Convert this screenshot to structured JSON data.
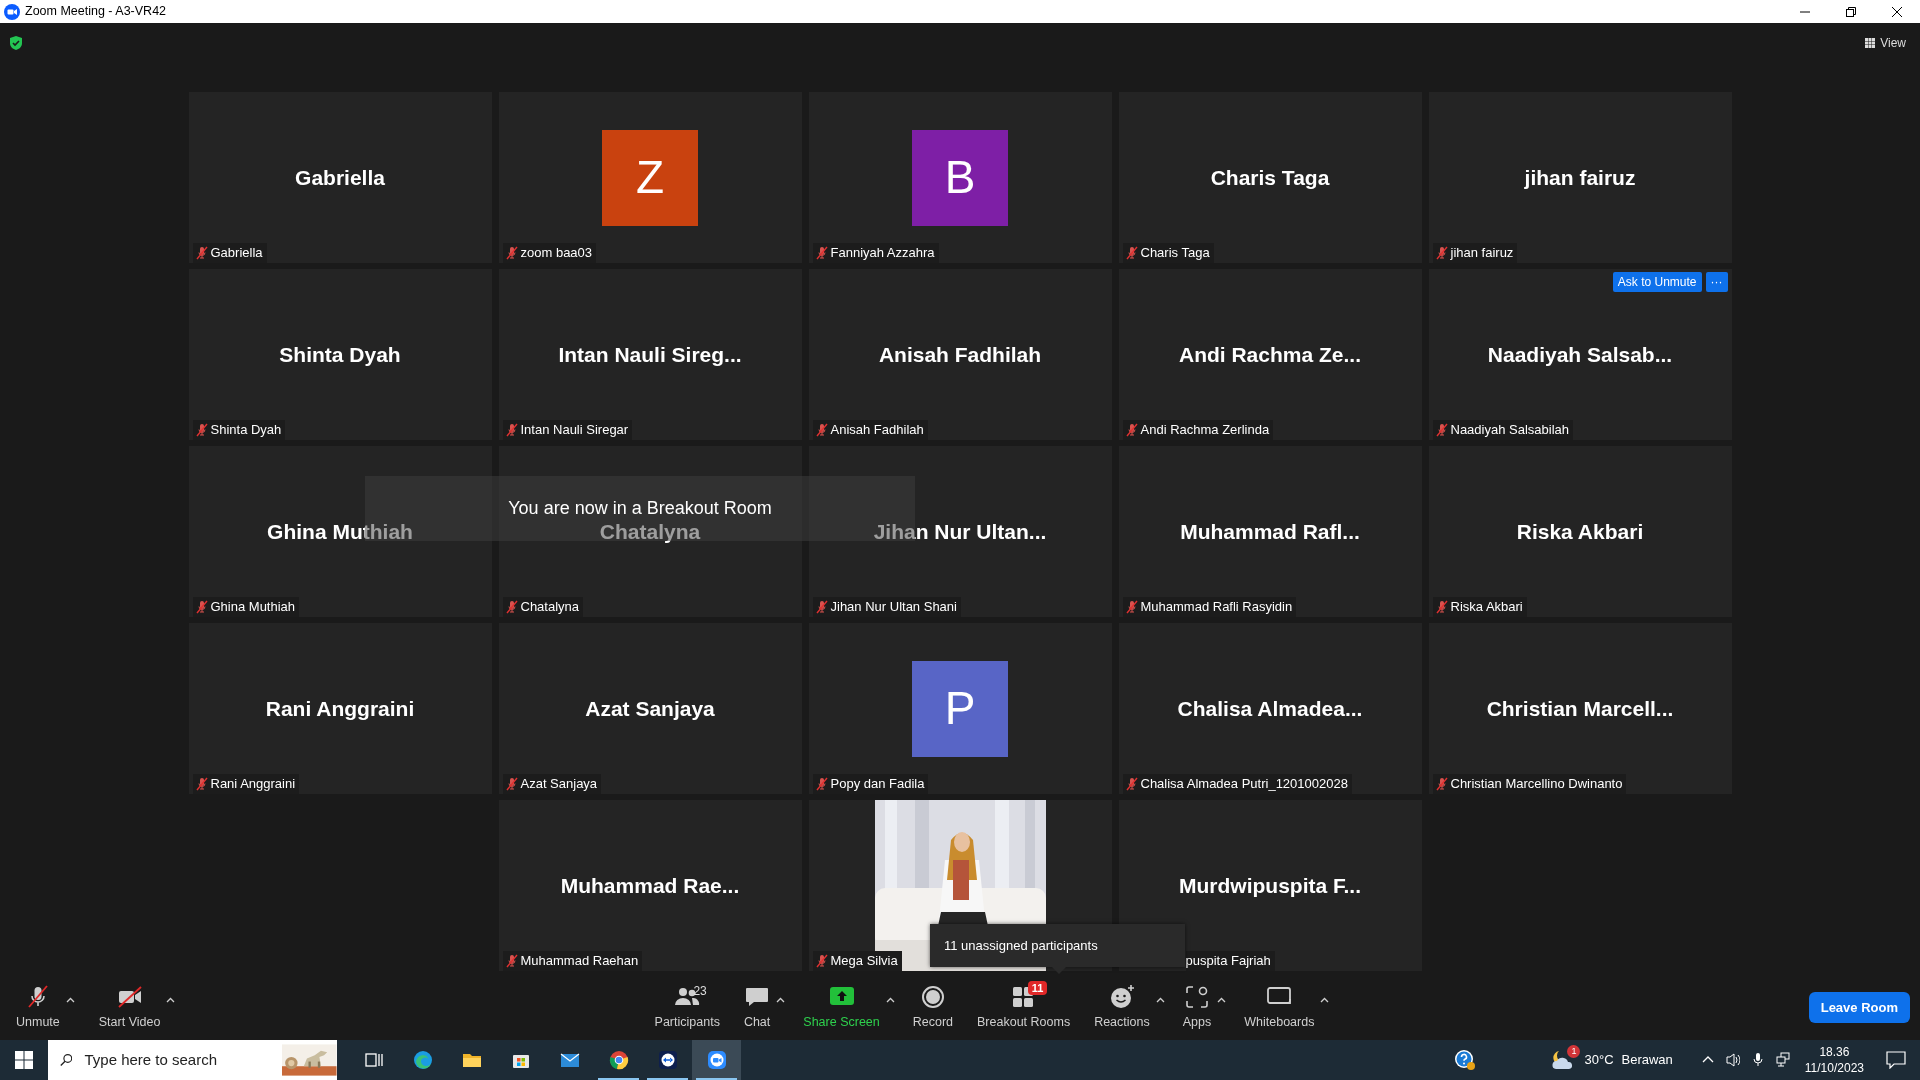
{
  "window": {
    "title": "Zoom Meeting - A3-VR42"
  },
  "top_bar": {
    "view_label": "View"
  },
  "tiles": [
    {
      "kind": "name",
      "display": "Gabriella",
      "label": "Gabriella",
      "muted": true
    },
    {
      "kind": "avatar",
      "display": "Z",
      "color": "#c9420f",
      "label": "zoom baa03",
      "muted": true
    },
    {
      "kind": "avatar",
      "display": "B",
      "color": "#7e1fa6",
      "label": "Fanniyah Azzahra",
      "muted": true
    },
    {
      "kind": "name",
      "display": "Charis Taga",
      "label": "Charis Taga",
      "muted": true
    },
    {
      "kind": "name",
      "display": "jihan fairuz",
      "label": "jihan fairuz",
      "muted": true
    },
    {
      "kind": "name",
      "display": "Shinta Dyah",
      "label": "Shinta Dyah",
      "muted": true
    },
    {
      "kind": "name",
      "display": "Intan Nauli Sireg...",
      "label": "Intan Nauli Siregar",
      "muted": true
    },
    {
      "kind": "name",
      "display": "Anisah Fadhilah",
      "label": "Anisah Fadhilah",
      "muted": true
    },
    {
      "kind": "name",
      "display": "Andi Rachma Ze...",
      "label": "Andi Rachma Zerlinda",
      "muted": true
    },
    {
      "kind": "name",
      "display": "Naadiyah Salsab...",
      "label": "Naadiyah Salsabilah",
      "muted": true,
      "actions": {
        "ask_to_unmute": "Ask to Unmute",
        "more": "···"
      }
    },
    {
      "kind": "name",
      "display": "Ghina Muthiah",
      "label": "Ghina Muthiah",
      "muted": true
    },
    {
      "kind": "name",
      "display": "Chatalyna",
      "label": "Chatalyna",
      "muted": true
    },
    {
      "kind": "name",
      "display": "Jihan Nur Ultan...",
      "label": "Jihan Nur Ultan Shani",
      "muted": true
    },
    {
      "kind": "name",
      "display": "Muhammad Rafl...",
      "label": "Muhammad Rafli Rasyidin",
      "muted": true
    },
    {
      "kind": "name",
      "display": "Riska Akbari",
      "label": "Riska Akbari",
      "muted": true
    },
    {
      "kind": "name",
      "display": "Rani Anggraini",
      "label": "Rani Anggraini",
      "muted": true
    },
    {
      "kind": "name",
      "display": "Azat Sanjaya",
      "label": "Azat Sanjaya",
      "muted": true
    },
    {
      "kind": "avatar",
      "display": "P",
      "color": "#5865c6",
      "label": "Popy dan Fadila",
      "muted": true
    },
    {
      "kind": "name",
      "display": "Chalisa Almadea...",
      "label": "Chalisa Almadea Putri_1201002028",
      "muted": true
    },
    {
      "kind": "name",
      "display": "Christian Marcell...",
      "label": "Christian Marcellino Dwinanto",
      "muted": true
    },
    {
      "kind": "name",
      "display": "Muhammad Rae...",
      "label": "Muhammad Raehan",
      "muted": true
    },
    {
      "kind": "video",
      "label": "Mega Silvia",
      "muted": true
    },
    {
      "kind": "name",
      "display": "Murdwipuspita F...",
      "label": "puspita Fajriah",
      "muted": true,
      "label_covered": true
    }
  ],
  "notice": "You are now in a Breakout Room",
  "tooltip": "11 unassigned participants",
  "toolbar": {
    "left": [
      {
        "kind": "mute",
        "label": "Unmute",
        "caret": true
      },
      {
        "kind": "video",
        "label": "Start Video",
        "caret": true
      }
    ],
    "center": [
      {
        "kind": "participants",
        "label": "Participants",
        "count": "23",
        "caret": false
      },
      {
        "kind": "chat",
        "label": "Chat",
        "caret": true
      },
      {
        "kind": "share",
        "label": "Share Screen",
        "caret": true
      },
      {
        "kind": "record",
        "label": "Record",
        "caret": false
      },
      {
        "kind": "breakout",
        "label": "Breakout Rooms",
        "badge": "11",
        "caret": false
      },
      {
        "kind": "reactions",
        "label": "Reactions",
        "caret": true
      },
      {
        "kind": "apps",
        "label": "Apps",
        "caret": true
      },
      {
        "kind": "whiteboards",
        "label": "Whiteboards",
        "caret": true
      }
    ],
    "leave": "Leave Room"
  },
  "taskbar": {
    "search_placeholder": "Type here to search",
    "apps": [
      {
        "kind": "taskview",
        "running": false,
        "selected": false
      },
      {
        "kind": "edge",
        "running": false,
        "selected": false
      },
      {
        "kind": "explorer",
        "running": false,
        "selected": false
      },
      {
        "kind": "store",
        "running": false,
        "selected": false
      },
      {
        "kind": "mail",
        "running": false,
        "selected": false
      },
      {
        "kind": "chrome",
        "running": true,
        "selected": false
      },
      {
        "kind": "teamviewer",
        "running": true,
        "selected": false
      },
      {
        "kind": "zoom",
        "running": true,
        "selected": true
      }
    ],
    "weather": {
      "badge": "1",
      "temperature": "30°C",
      "condition": "Berawan"
    },
    "time": "18.36",
    "date": "11/10/2023"
  }
}
